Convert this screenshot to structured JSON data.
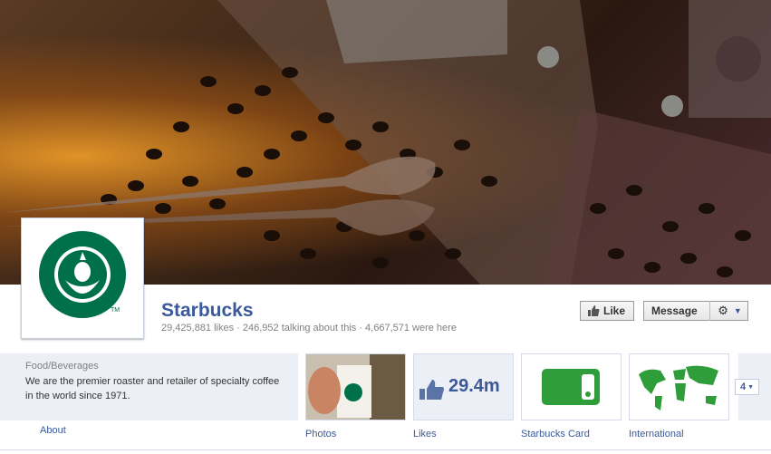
{
  "page": {
    "name": "Starbucks",
    "stats": "29,425,881 likes · 246,952 talking about this · 4,667,571 were here"
  },
  "actions": {
    "like_label": "Like",
    "message_label": "Message",
    "options_icon": "gear-icon",
    "like_icon": "thumbs-up-icon"
  },
  "about": {
    "category": "Food/Beverages",
    "description": "We are the premier roaster and retailer of specialty coffee in the world since 1971.",
    "link_label": "About"
  },
  "apps": [
    {
      "label": "Photos"
    },
    {
      "label": "Likes",
      "value": "29.4m"
    },
    {
      "label": "Starbucks Card"
    },
    {
      "label": "International"
    }
  ],
  "more_count": "4",
  "colors": {
    "brand_blue": "#3b5998",
    "starbucks_green": "#00704a",
    "card_green": "#2f9e3a"
  }
}
